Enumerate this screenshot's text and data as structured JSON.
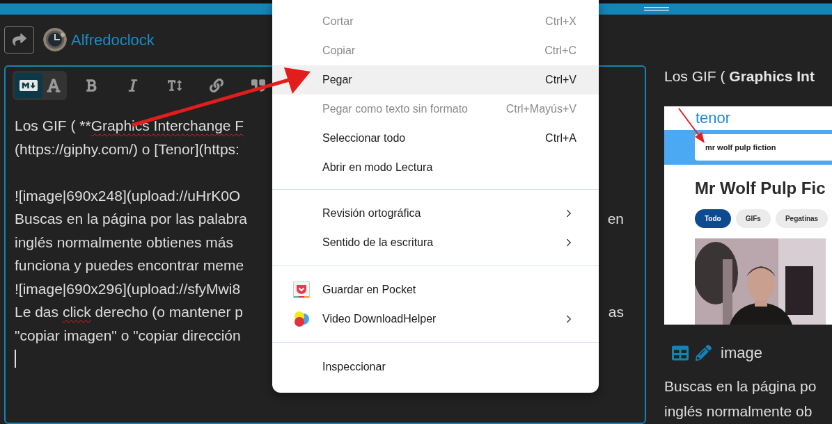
{
  "author": {
    "name": "Alfredoclock"
  },
  "editor": {
    "mode_toggle": [
      {
        "kind": "markdown",
        "selected": true
      },
      {
        "kind": "rich_text",
        "selected": false
      }
    ],
    "tools": [
      {
        "kind": "bold"
      },
      {
        "kind": "italic"
      },
      {
        "kind": "heading"
      },
      {
        "kind": "link"
      },
      {
        "kind": "quote"
      }
    ],
    "lines": [
      {
        "segments": [
          {
            "text": "Los GIF ( **"
          },
          {
            "text": "Graphics Interchange F",
            "misspelled": true
          }
        ]
      },
      {
        "segments": [
          {
            "text": "(https://giphy.com/) o [Tenor](https:"
          }
        ]
      },
      {
        "space_before": true,
        "segments": [
          {
            "text": "![image|690x248](upload://uHrK0O"
          }
        ]
      },
      {
        "segments": [
          {
            "text": "Buscas en la página por las palabra"
          }
        ],
        "tail": "en"
      },
      {
        "segments": [
          {
            "text": "inglés normalmente obtienes más"
          }
        ]
      },
      {
        "segments": [
          {
            "text": "funciona y puedes encontrar meme"
          }
        ]
      },
      {
        "segments": [
          {
            "text": "![image|690x296](upload://sfyMwi8"
          }
        ]
      },
      {
        "segments": [
          {
            "text": "Le das "
          },
          {
            "text": "click",
            "misspelled": true
          },
          {
            "text": " derecho (o mantener p"
          }
        ],
        "tail": "as"
      },
      {
        "segments": [
          {
            "text": "\"copiar imagen\" o \"copiar dirección"
          }
        ]
      }
    ]
  },
  "preview": {
    "heading": "Los GIF ( **Graphics Int**",
    "image": {
      "logo": "tenor",
      "search": "mr wolf pulp fiction",
      "title": "Mr Wolf Pulp Fic",
      "chips": [
        {
          "label": "Todo",
          "selected": true
        },
        {
          "label": "GIFs",
          "selected": false
        },
        {
          "label": "Pegatinas",
          "selected": false
        }
      ]
    },
    "caption": "image",
    "lines": [
      "Buscas en la página po",
      "inglés normalmente ob"
    ]
  },
  "context_menu": {
    "groups": [
      [
        {
          "kind": "plain",
          "label": "Cortar",
          "shortcut": "Ctrl+X",
          "disabled": true,
          "selected": false,
          "submenu": false
        },
        {
          "kind": "plain",
          "label": "Copiar",
          "shortcut": "Ctrl+C",
          "disabled": true,
          "selected": false,
          "submenu": false
        },
        {
          "kind": "plain",
          "label": "Pegar",
          "shortcut": "Ctrl+V",
          "disabled": false,
          "selected": true,
          "submenu": false
        },
        {
          "kind": "plain",
          "label": "Pegar como texto sin formato",
          "shortcut": "Ctrl+Mayús+V",
          "disabled": true,
          "selected": false,
          "submenu": false
        },
        {
          "kind": "plain",
          "label": "Seleccionar todo",
          "shortcut": "Ctrl+A",
          "disabled": false,
          "selected": false,
          "submenu": false
        },
        {
          "kind": "plain",
          "label": "Abrir en modo Lectura",
          "disabled": false,
          "selected": false,
          "submenu": false
        }
      ],
      [
        {
          "kind": "plain",
          "label": "Revisión ortográfica",
          "disabled": false,
          "selected": false,
          "submenu": true
        },
        {
          "kind": "plain",
          "label": "Sentido de la escritura",
          "disabled": false,
          "selected": false,
          "submenu": true
        }
      ],
      [
        {
          "kind": "pocket",
          "label": "Guardar en Pocket",
          "disabled": false,
          "selected": false,
          "submenu": false
        },
        {
          "kind": "downloadhelper",
          "label": "Video DownloadHelper",
          "disabled": false,
          "selected": false,
          "submenu": true
        }
      ],
      [
        {
          "kind": "plain",
          "label": "Inspeccionar",
          "disabled": false,
          "selected": false,
          "submenu": false
        }
      ]
    ]
  }
}
